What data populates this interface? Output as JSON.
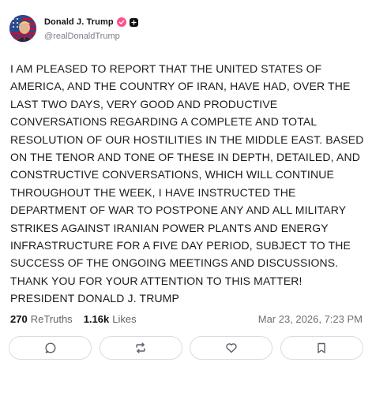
{
  "author": {
    "display_name": "Donald J. Trump",
    "handle": "@realDonaldTrump",
    "avatar_icon": "avatar-flag-portrait",
    "verified_color": "#ff4f8b"
  },
  "post": {
    "text": "I AM PLEASED TO REPORT THAT THE UNITED STATES OF AMERICA, AND THE COUNTRY OF IRAN, HAVE HAD, OVER THE LAST TWO DAYS, VERY GOOD AND PRODUCTIVE CONVERSATIONS REGARDING A COMPLETE AND TOTAL RESOLUTION OF OUR HOSTILITIES IN THE MIDDLE EAST. BASED ON THE TENOR AND TONE OF THESE IN DEPTH, DETAILED, AND CONSTRUCTIVE CONVERSATIONS, WHICH WILL CONTINUE THROUGHOUT THE WEEK, I HAVE INSTRUCTED THE DEPARTMENT OF WAR TO POSTPONE ANY AND ALL MILITARY STRIKES AGAINST IRANIAN POWER PLANTS AND ENERGY INFRASTRUCTURE FOR A FIVE DAY PERIOD, SUBJECT TO THE SUCCESS OF THE ONGOING MEETINGS AND DISCUSSIONS. THANK YOU FOR YOUR ATTENTION TO THIS MATTER! PRESIDENT DONALD J. TRUMP"
  },
  "stats": {
    "retruths_count": "270",
    "retruths_label": "ReTruths",
    "likes_count": "1.16k",
    "likes_label": "Likes",
    "timestamp": "Mar 23, 2026, 7:23 PM"
  },
  "actions": [
    {
      "name": "reply",
      "icon": "speech-bubble-icon"
    },
    {
      "name": "retruth",
      "icon": "repost-arrows-icon"
    },
    {
      "name": "like",
      "icon": "heart-icon"
    },
    {
      "name": "bookmark",
      "icon": "bookmark-icon"
    }
  ]
}
